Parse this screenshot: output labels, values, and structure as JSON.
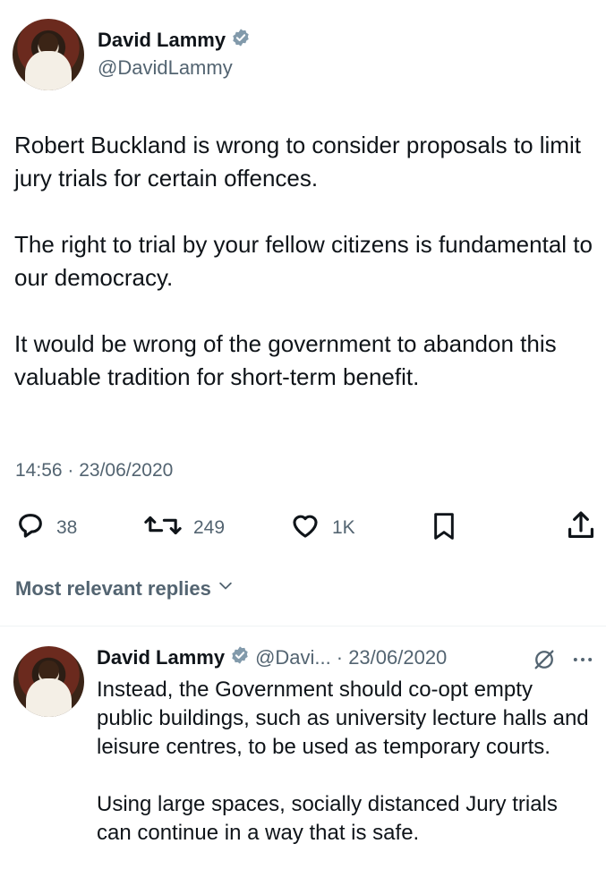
{
  "tweet": {
    "author_name": "David Lammy",
    "author_handle": "@DavidLammy",
    "paragraphs": [
      "Robert Buckland is wrong to consider proposals to limit jury trials for certain offences.",
      "The right to trial by your fellow citizens is fundamental to our democracy.",
      "It would be wrong of the government to abandon this valuable tradition for short-term benefit."
    ],
    "timestamp": "14:56 · 23/06/2020",
    "actions": {
      "replies": "38",
      "retweets": "249",
      "likes": "1K"
    }
  },
  "replies_filter": {
    "label": "Most relevant replies"
  },
  "reply": {
    "author_name": "David Lammy",
    "author_handle": "@Davi...",
    "date": "· 23/06/2020",
    "paragraphs": [
      "Instead, the Government should co-opt empty public buildings, such as university lecture halls and leisure centres, to be used as temporary courts.",
      "Using large spaces, socially distanced Jury trials can continue in a way that is safe."
    ]
  },
  "colors": {
    "text": "#0f1419",
    "secondary": "#536471",
    "verified": "#829aab",
    "divider": "#eff3f4"
  },
  "icons": {
    "reply": "speech-bubble",
    "retweet": "retweet-arrows",
    "like": "heart",
    "bookmark": "bookmark",
    "share": "share-upload",
    "grok": "circle-slash",
    "more": "ellipsis"
  }
}
